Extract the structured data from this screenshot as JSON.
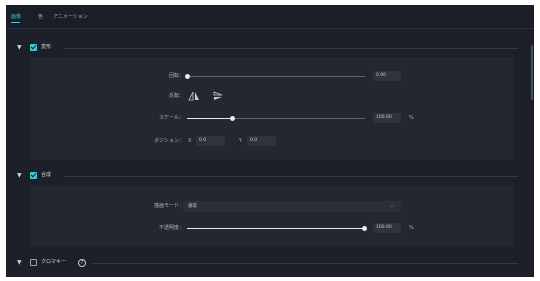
{
  "tabs": [
    {
      "label": "画像",
      "active": true
    },
    {
      "label": "色",
      "active": false
    },
    {
      "label": "アニメーション",
      "active": false
    }
  ],
  "transform": {
    "title": "変形",
    "checked": true,
    "rotation": {
      "label": "回転：",
      "value": "0.00"
    },
    "flip": {
      "label": "反転：",
      "icons": [
        "flip-vertical-icon",
        "flip-horizontal-icon"
      ]
    },
    "scale": {
      "label": "スケール：",
      "value": "100.00",
      "unit": "%",
      "level": 0.25
    },
    "position": {
      "label": "ポジション：",
      "x_label": "X",
      "x_value": "0.0",
      "y_label": "Y",
      "y_value": "0.0"
    }
  },
  "compositing": {
    "title": "合成",
    "checked": true,
    "blend_mode": {
      "label": "描画モード：",
      "value": "通常"
    },
    "opacity": {
      "label": "不透明度：",
      "value": "100.00",
      "unit": "%",
      "level": 1.0
    }
  },
  "chroma_key": {
    "title": "クロマキー",
    "checked": false,
    "help_symbol": "?"
  },
  "colors": {
    "accent": "#3ec8d8",
    "background": "#1c2129",
    "panel": "#232830"
  }
}
